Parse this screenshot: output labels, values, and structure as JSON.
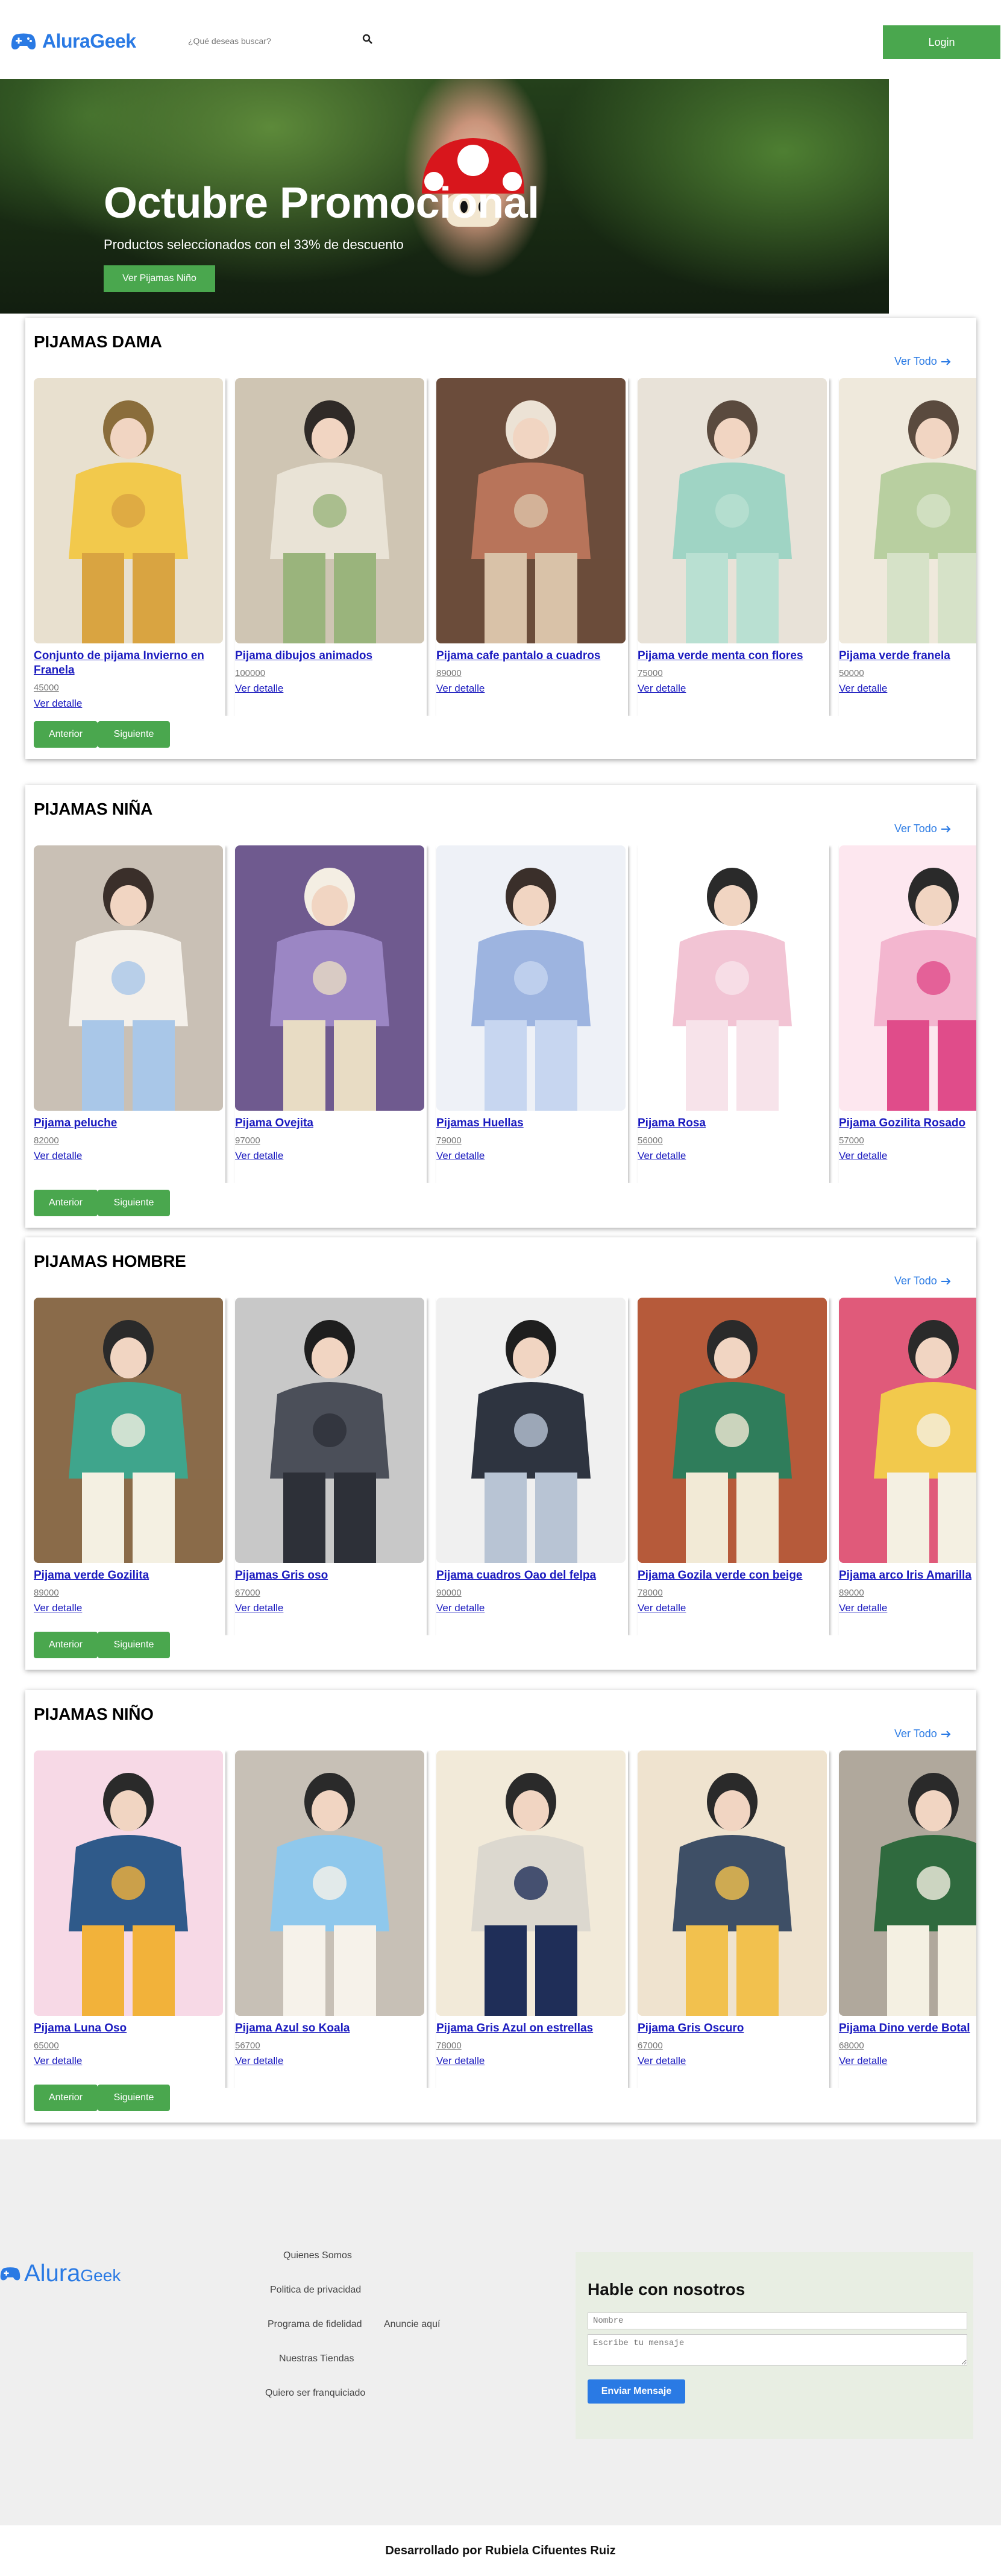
{
  "header": {
    "logo_text": "AluraGeek",
    "search_placeholder": "¿Qué deseas buscar?",
    "login_label": "Login"
  },
  "hero": {
    "title": "Octubre Promocional",
    "subtitle": "Productos seleccionados con el 33% de descuento",
    "button_label": "Ver Pijamas Niño"
  },
  "common": {
    "ver_todo": "Ver Todo",
    "ver_detalle": "Ver detalle",
    "anterior": "Anterior",
    "siguiente": "Siguiente"
  },
  "sections": [
    {
      "title": "PIJAMAS DAMA",
      "products": [
        {
          "name": "Conjunto de pijama Invierno en Franela",
          "price": "45000"
        },
        {
          "name": "Pijama dibujos animados",
          "price": "100000"
        },
        {
          "name": "Pijama cafe pantalo a cuadros",
          "price": "89000"
        },
        {
          "name": "Pijama verde menta con flores",
          "price": "75000"
        },
        {
          "name": "Pijama verde franela",
          "price": "50000"
        }
      ]
    },
    {
      "title": "PIJAMAS NIÑA",
      "products": [
        {
          "name": "Pijama peluche",
          "price": "82000"
        },
        {
          "name": "Pijama Ovejita",
          "price": "97000"
        },
        {
          "name": "Pijamas Huellas",
          "price": "79000"
        },
        {
          "name": "Pijama Rosa",
          "price": "56000"
        },
        {
          "name": "Pijama Gozilita Rosado",
          "price": "57000"
        }
      ]
    },
    {
      "title": "PIJAMAS HOMBRE",
      "products": [
        {
          "name": "Pijama verde Gozilita",
          "price": "89000"
        },
        {
          "name": "Pijamas Gris oso",
          "price": "67000"
        },
        {
          "name": "Pijama cuadros Oao del felpa",
          "price": "90000"
        },
        {
          "name": "Pijama Gozila verde con beige",
          "price": "78000"
        },
        {
          "name": "Pijama arco Iris Amarilla",
          "price": "89000"
        }
      ]
    },
    {
      "title": "PIJAMAS NIÑO",
      "products": [
        {
          "name": "Pijama Luna Oso",
          "price": "65000"
        },
        {
          "name": "Pijama Azul so Koala",
          "price": "56700"
        },
        {
          "name": "Pijama Gris Azul on estrellas",
          "price": "78000"
        },
        {
          "name": "Pijama Gris Oscuro",
          "price": "67000"
        },
        {
          "name": "Pijama Dino verde Botal",
          "price": "68000"
        }
      ]
    }
  ],
  "footer": {
    "logo_main": "Alura",
    "logo_small": "Geek",
    "links": [
      "Quienes Somos",
      "Politica de privacidad",
      "Programa de fidelidad",
      "Anuncie aquí",
      "Nuestras Tiendas",
      "Quiero ser franquiciado"
    ],
    "contact_title": "Hable con nosotros",
    "contact_name_placeholder": "Nombre",
    "contact_msg_placeholder": "Escribe tu mensaje",
    "contact_button": "Enviar Mensaje"
  },
  "credits": "Desarrollado por Rubiela Cifuentes Ruiz",
  "colors": {
    "brand_blue": "#2a7ae4",
    "button_green": "#4aa74e",
    "link_blue": "#1a1abf"
  }
}
